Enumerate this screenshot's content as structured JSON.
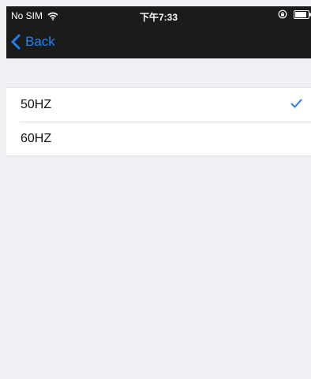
{
  "status_bar": {
    "carrier": "No SIM",
    "time": "下午7:33",
    "icons": [
      "wifi-icon",
      "rotation-lock-icon",
      "battery-icon"
    ]
  },
  "nav": {
    "back_label": "Back",
    "back_icon": "chevron-left-icon"
  },
  "frequency_list": {
    "items": [
      {
        "label": "50HZ",
        "selected": true
      },
      {
        "label": "60HZ",
        "selected": false
      }
    ]
  },
  "colors": {
    "header_bg": "#1b1b1b",
    "accent": "#1f83f5",
    "page_bg": "#efeff4"
  }
}
